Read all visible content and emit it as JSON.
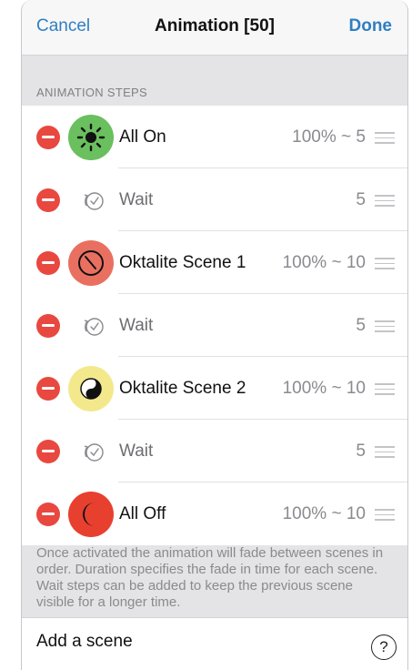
{
  "nav": {
    "cancel_label": "Cancel",
    "title": "Animation [50]",
    "done_label": "Done"
  },
  "section_header": "ANIMATION STEPS",
  "steps": [
    {
      "label": "All On",
      "value": "100% ~ 5",
      "kind": "scene",
      "icon": "sun-icon",
      "icon_bg": "#6abf5e"
    },
    {
      "label": "Wait",
      "value": "5",
      "kind": "wait",
      "icon": "timer-icon"
    },
    {
      "label": "Oktalite Scene 1",
      "value": "100% ~ 10",
      "kind": "scene",
      "icon": "clock-icon",
      "icon_bg": "#e97060"
    },
    {
      "label": "Wait",
      "value": "5",
      "kind": "wait",
      "icon": "timer-icon"
    },
    {
      "label": "Oktalite Scene 2",
      "value": "100% ~ 10",
      "kind": "scene",
      "icon": "yin-yang-icon",
      "icon_bg": "#f3e98c"
    },
    {
      "label": "Wait",
      "value": "5",
      "kind": "wait",
      "icon": "timer-icon"
    },
    {
      "label": "All Off",
      "value": "100% ~ 10",
      "kind": "scene",
      "icon": "moon-icon",
      "icon_bg": "#e8402f"
    }
  ],
  "footer_note": "Once activated the animation will fade between scenes in order. Duration specifies the fade in time for each scene. Wait steps can be added to keep the previous scene visible for a longer time.",
  "add_scene_label": "Add a scene",
  "help_label": "?",
  "colors": {
    "accent": "#2f7fc1",
    "delete": "#e8483f",
    "background": "#e4e4e6"
  }
}
